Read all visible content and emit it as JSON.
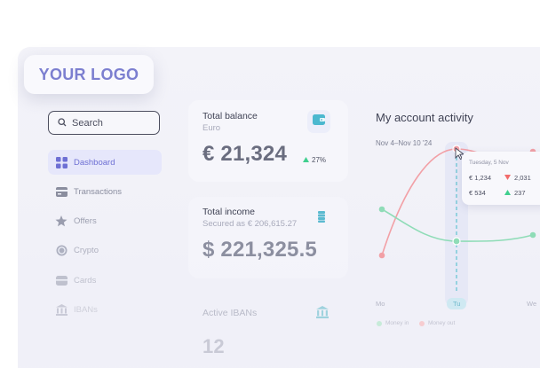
{
  "logo": {
    "text": "YOUR LOGO"
  },
  "search": {
    "label": "Search"
  },
  "sidebar": {
    "items": [
      {
        "label": "Dashboard",
        "icon": "grid-icon"
      },
      {
        "label": "Transactions",
        "icon": "card-icon"
      },
      {
        "label": "Offers",
        "icon": "star-icon"
      },
      {
        "label": "Crypto",
        "icon": "coin-icon"
      },
      {
        "label": "Cards",
        "icon": "wallet-icon"
      },
      {
        "label": "IBANs",
        "icon": "bank-icon"
      }
    ]
  },
  "balance": {
    "title": "Total balance",
    "currency": "Euro",
    "amount": "€ 21,324",
    "change": "27%"
  },
  "income": {
    "title": "Total income",
    "secured": "Secured as € 206,615.27",
    "amount": "$ 221,325.5"
  },
  "ibans": {
    "title": "Active IBANs",
    "count": "12"
  },
  "activity": {
    "title": "My account activity",
    "range": "Nov 4–Nov 10 '24",
    "tooltip": {
      "date": "Tuesday, 5 Nov",
      "rows": [
        {
          "value": "€ 1,234",
          "delta": "2,031",
          "dir": "down"
        },
        {
          "value": "€ 534",
          "delta": "237",
          "dir": "up"
        }
      ]
    },
    "x_labels": [
      "Mo",
      "Tu",
      "We"
    ],
    "legend": [
      "Money in",
      "Money out"
    ]
  },
  "colors": {
    "accent": "#7c7fd0",
    "money_in": "#8fdcb7",
    "money_out": "#f2a0a6",
    "up": "#3fcf8e",
    "down": "#f26b6b"
  }
}
